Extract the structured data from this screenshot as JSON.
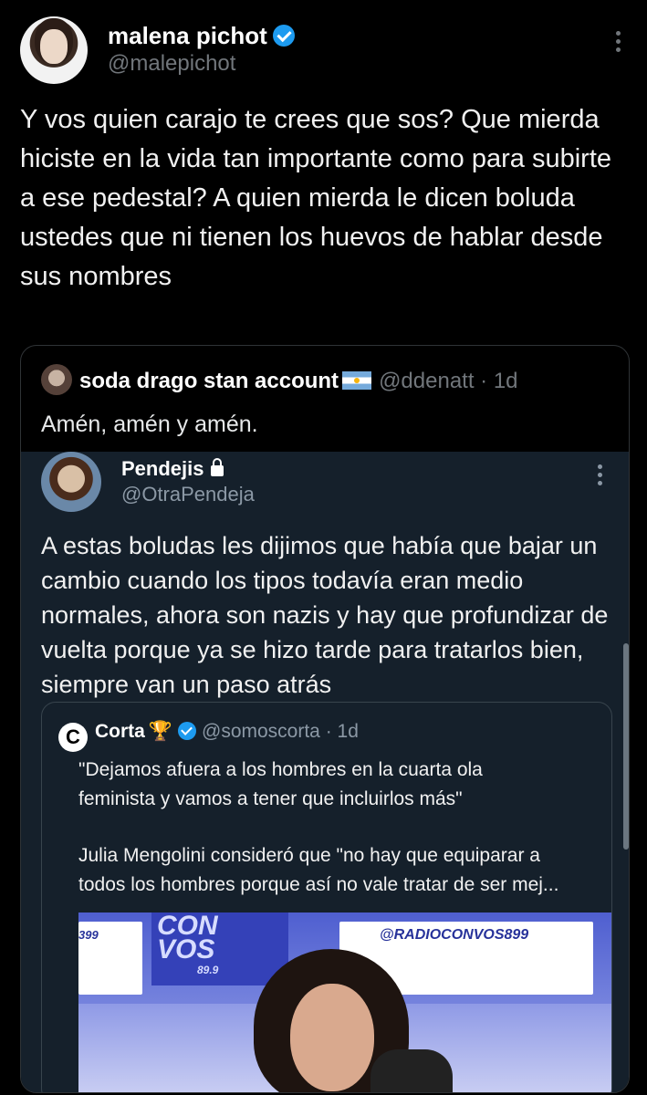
{
  "tweet": {
    "author_name": "malena pichot",
    "author_handle": "@malepichot",
    "text": "Y vos quien carajo te crees que sos? Que mierda hiciste en la vida tan importante como para subirte a ese pedestal? A quien mierda le dicen boluda ustedes que ni tienen los huevos de hablar desde sus nombres"
  },
  "quote": {
    "author_name": "soda drago stan account",
    "author_handle": "@ddenatt",
    "time": "· 1d",
    "flag_icon": "argentina-flag-icon",
    "text": "Amén, amén y amén."
  },
  "embedded": {
    "author_name": "Pendejis",
    "author_handle": "@OtraPendeja",
    "text": "A estas boludas les dijimos que había que bajar un cambio cuando los tipos todavía eran medio normales, ahora son nazis y hay que profundizar de vuelta porque ya se hizo tarde para tratarlos bien, siempre van un paso atrás",
    "nested": {
      "logo": "C",
      "author_name": "Corta",
      "trophy": "🏆",
      "author_handle": "@somoscorta",
      "time": "· 1d",
      "line1": "\"Dejamos afuera a los hombres en la cuarta ola",
      "line2": "feminista y vamos a tener que incluirlos más\"",
      "line3": "Julia Mengolini consideró que \"no hay que equiparar a",
      "line4": "todos los hombres porque así no vale tratar de ser mej...",
      "media": {
        "sign_left": "399",
        "logo_line1": "CON",
        "logo_line2": "VOS",
        "logo_sub": "89.9",
        "sign_right": "@RADIOCONVOS899"
      }
    }
  },
  "colors": {
    "background": "#000000",
    "embed_background": "#15202b",
    "verified": "#1d9bf0",
    "muted": "#71767b"
  }
}
